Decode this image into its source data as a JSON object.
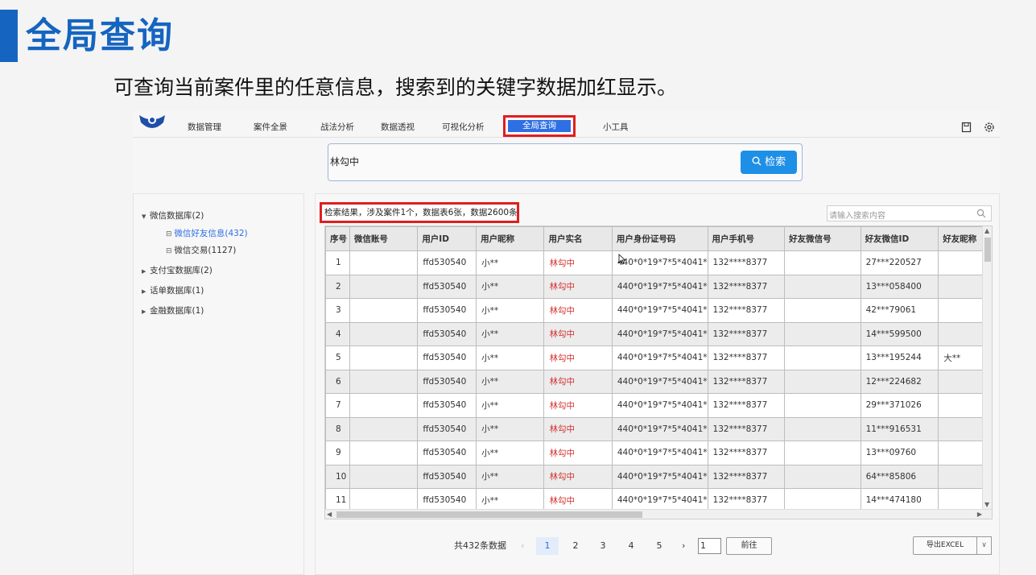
{
  "slide": {
    "title": "全局查询",
    "subtitle": "可查询当前案件里的任意信息，搜索到的关键字数据加红显示。"
  },
  "nav": {
    "items": [
      "数据管理",
      "案件全景",
      "战法分析",
      "数据透视",
      "可视化分析",
      "全局查询",
      "小工具"
    ],
    "active": "全局查询",
    "icons": [
      "save-icon",
      "gear-icon"
    ]
  },
  "search": {
    "value": "林勾中",
    "button_label": "检索",
    "button_icon": "search-icon"
  },
  "sidebar": {
    "tree": [
      {
        "label": "微信数据库(2)",
        "expanded": true
      },
      {
        "label": "微信好友信息(432)",
        "child": true,
        "active": true
      },
      {
        "label": "微信交易(1127)",
        "child": true
      },
      {
        "label": "支付宝数据库(2)",
        "expanded": false
      },
      {
        "label": "话单数据库(1)",
        "expanded": false
      },
      {
        "label": "金融数据库(1)",
        "expanded": false
      }
    ]
  },
  "results": {
    "summary": "检索结果，涉及案件1个，数据表6张，数据2600条",
    "filter_placeholder": "请输入搜索内容"
  },
  "table": {
    "columns": [
      "序号",
      "微信账号",
      "用户ID",
      "用户昵称",
      "用户实名",
      "用户身份证号码",
      "用户手机号",
      "好友微信号",
      "好友微信ID",
      "好友昵称"
    ],
    "rows": [
      [
        "1",
        "",
        "ffd530540",
        "小**",
        "林勾中",
        "440*0*19*7*5*4041*",
        "132****8377",
        "",
        "27***220527",
        ""
      ],
      [
        "2",
        "",
        "ffd530540",
        "小**",
        "林勾中",
        "440*0*19*7*5*4041*",
        "132****8377",
        "",
        "13***058400",
        ""
      ],
      [
        "3",
        "",
        "ffd530540",
        "小**",
        "林勾中",
        "440*0*19*7*5*4041*",
        "132****8377",
        "",
        "42***79061",
        ""
      ],
      [
        "4",
        "",
        "ffd530540",
        "小**",
        "林勾中",
        "440*0*19*7*5*4041*",
        "132****8377",
        "",
        "14***599500",
        ""
      ],
      [
        "5",
        "",
        "ffd530540",
        "小**",
        "林勾中",
        "440*0*19*7*5*4041*",
        "132****8377",
        "",
        "13***195244",
        "大**"
      ],
      [
        "6",
        "",
        "ffd530540",
        "小**",
        "林勾中",
        "440*0*19*7*5*4041*",
        "132****8377",
        "",
        "12***224682",
        ""
      ],
      [
        "7",
        "",
        "ffd530540",
        "小**",
        "林勾中",
        "440*0*19*7*5*4041*",
        "132****8377",
        "",
        "29***371026",
        ""
      ],
      [
        "8",
        "",
        "ffd530540",
        "小**",
        "林勾中",
        "440*0*19*7*5*4041*",
        "132****8377",
        "",
        "11***916531",
        ""
      ],
      [
        "9",
        "",
        "ffd530540",
        "小**",
        "林勾中",
        "440*0*19*7*5*4041*",
        "132****8377",
        "",
        "13***09760",
        ""
      ],
      [
        "10",
        "",
        "ffd530540",
        "小**",
        "林勾中",
        "440*0*19*7*5*4041*",
        "132****8377",
        "",
        "64***85806",
        ""
      ],
      [
        "11",
        "",
        "ffd530540",
        "小**",
        "林勾中",
        "440*0*19*7*5*4041*",
        "132****8377",
        "",
        "14***474180",
        ""
      ]
    ],
    "highlight_color": "#d32f2f"
  },
  "pagination": {
    "total_text": "共432条数据",
    "pages": [
      "1",
      "2",
      "3",
      "4",
      "5"
    ],
    "current": "1",
    "prev": "‹",
    "next": "›",
    "goto_value": "1",
    "goto_label": "前往"
  },
  "export": {
    "label": "导出EXCEL",
    "dropdown_icon": "chevron-down-icon"
  },
  "colors": {
    "brand": "#1565c0",
    "accent": "#2f6fe4",
    "annotation": "#e01e1e"
  }
}
